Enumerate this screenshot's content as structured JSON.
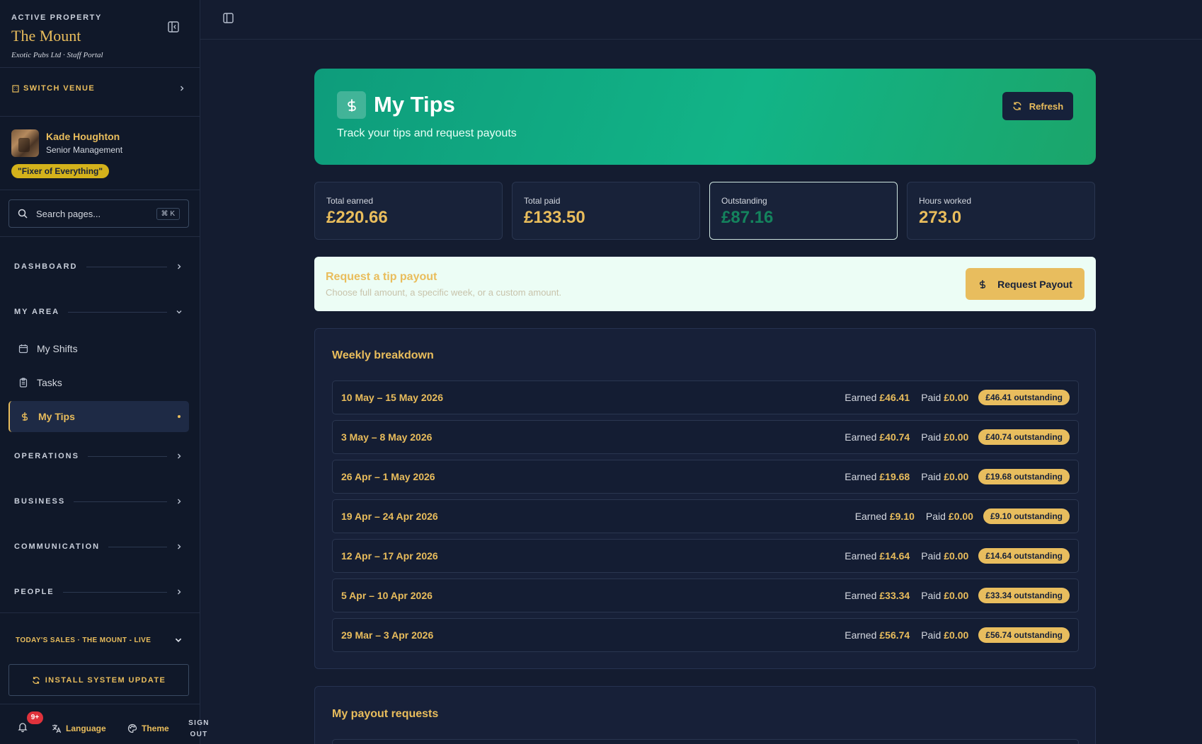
{
  "sidebar": {
    "eyebrow": "ACTIVE PROPERTY",
    "property_name": "The Mount",
    "property_sub": "Exotic Pubs Ltd · Staff Portal",
    "switch_venue": "SWITCH VENUE",
    "user": {
      "name": "Kade Houghton",
      "role": "Senior Management",
      "badge": "\"Fixer of Everything\""
    },
    "search": {
      "placeholder": "Search pages...",
      "shortcut": "⌘ K"
    },
    "sections": {
      "dashboard": "DASHBOARD",
      "my_area": "MY AREA",
      "operations": "OPERATIONS",
      "business": "BUSINESS",
      "communication": "COMMUNICATION",
      "people": "PEOPLE"
    },
    "items": [
      {
        "label": "My Shifts",
        "icon": "calendar-icon"
      },
      {
        "label": "Tasks",
        "icon": "clipboard-icon"
      },
      {
        "label": "My Tips",
        "icon": "dollar-icon",
        "active": true
      }
    ],
    "sales": "TODAY'S SALES · THE MOUNT - LIVE",
    "install": "INSTALL SYSTEM UPDATE",
    "footer": {
      "notifications": "9+",
      "language": "Language",
      "theme": "Theme",
      "sign_out": "SIGN OUT"
    }
  },
  "hero": {
    "title": "My Tips",
    "subtitle": "Track your tips and request payouts",
    "refresh": "Refresh"
  },
  "stats": [
    {
      "label": "Total earned",
      "value": "£220.66"
    },
    {
      "label": "Total paid",
      "value": "£133.50"
    },
    {
      "label": "Outstanding",
      "value": "£87.16"
    },
    {
      "label": "Hours worked",
      "value": "273.0"
    }
  ],
  "payout": {
    "title": "Request a tip payout",
    "subtitle": "Choose full amount, a specific week, or a custom amount.",
    "button": "Request Payout"
  },
  "weekly": {
    "title": "Weekly breakdown",
    "earned_label": "Earned",
    "paid_label": "Paid",
    "rows": [
      {
        "week": "10 May – 15 May 2026",
        "earned": "£46.41",
        "paid": "£0.00",
        "outstanding": "£46.41 outstanding"
      },
      {
        "week": "3 May – 8 May 2026",
        "earned": "£40.74",
        "paid": "£0.00",
        "outstanding": "£40.74 outstanding"
      },
      {
        "week": "26 Apr – 1 May 2026",
        "earned": "£19.68",
        "paid": "£0.00",
        "outstanding": "£19.68 outstanding"
      },
      {
        "week": "19 Apr – 24 Apr 2026",
        "earned": "£9.10",
        "paid": "£0.00",
        "outstanding": "£9.10 outstanding"
      },
      {
        "week": "12 Apr – 17 Apr 2026",
        "earned": "£14.64",
        "paid": "£0.00",
        "outstanding": "£14.64 outstanding"
      },
      {
        "week": "5 Apr – 10 Apr 2026",
        "earned": "£33.34",
        "paid": "£0.00",
        "outstanding": "£33.34 outstanding"
      },
      {
        "week": "29 Mar – 3 Apr 2026",
        "earned": "£56.74",
        "paid": "£0.00",
        "outstanding": "£56.74 outstanding"
      }
    ]
  },
  "payout_requests": {
    "title": "My payout requests"
  },
  "colors": {
    "accent": "#e9bd5c",
    "brand_green": "#12b487",
    "sidebar_bg": "#101829",
    "page_bg": "#141c30",
    "badge_red": "#e0323c"
  }
}
